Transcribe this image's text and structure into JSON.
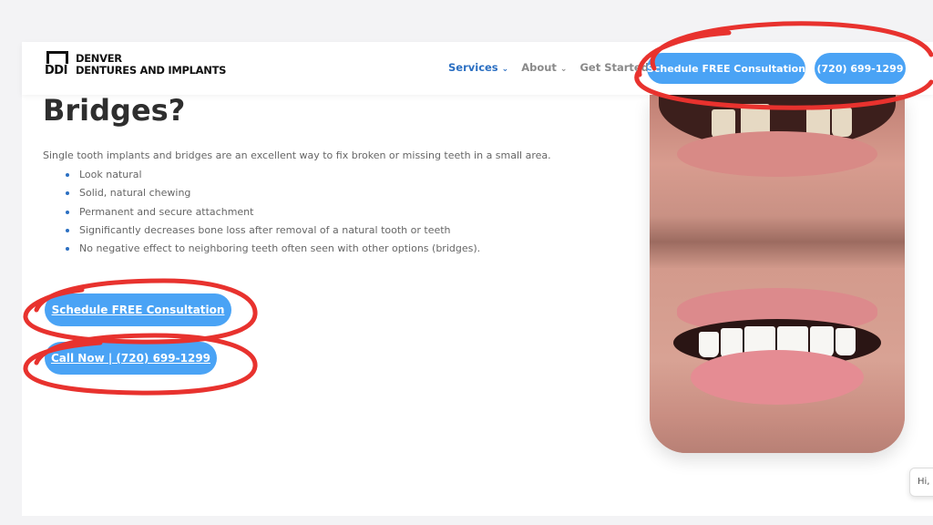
{
  "brand": {
    "mark": "DDI",
    "line1": "DENVER",
    "line2": "DENTURES AND IMPLANTS"
  },
  "nav": {
    "items": [
      {
        "label": "Services",
        "active": true,
        "has_dropdown": true
      },
      {
        "label": "About",
        "active": false,
        "has_dropdown": true
      },
      {
        "label": "Get Started",
        "active": false,
        "has_dropdown": true
      }
    ],
    "chevron_icon": "chevron-down-icon"
  },
  "header_buttons": {
    "consultation": "Schedule FREE Consultation",
    "phone": "(720) 699-1299"
  },
  "content": {
    "title": "Bridges?",
    "intro": "Single tooth implants and bridges are an excellent way to fix broken or missing teeth in a small area.",
    "benefits": [
      "Look natural",
      "Solid, natural chewing",
      "Permanent and secure attachment",
      "Significantly decreases bone loss after removal of a natural tooth or teeth",
      "No negative effect to neighboring teeth often seen with other options (bridges)."
    ],
    "cta_consultation": "Schedule FREE Consultation",
    "cta_call": "Call Now | (720) 699-1299"
  },
  "photo": {
    "description": "before-and-after-smile"
  },
  "chat_widget": {
    "text": "Hi, h"
  },
  "colors": {
    "accent_blue": "#4aa3f5",
    "nav_active": "#2b6fc2",
    "annotation_red": "#e8322e"
  }
}
